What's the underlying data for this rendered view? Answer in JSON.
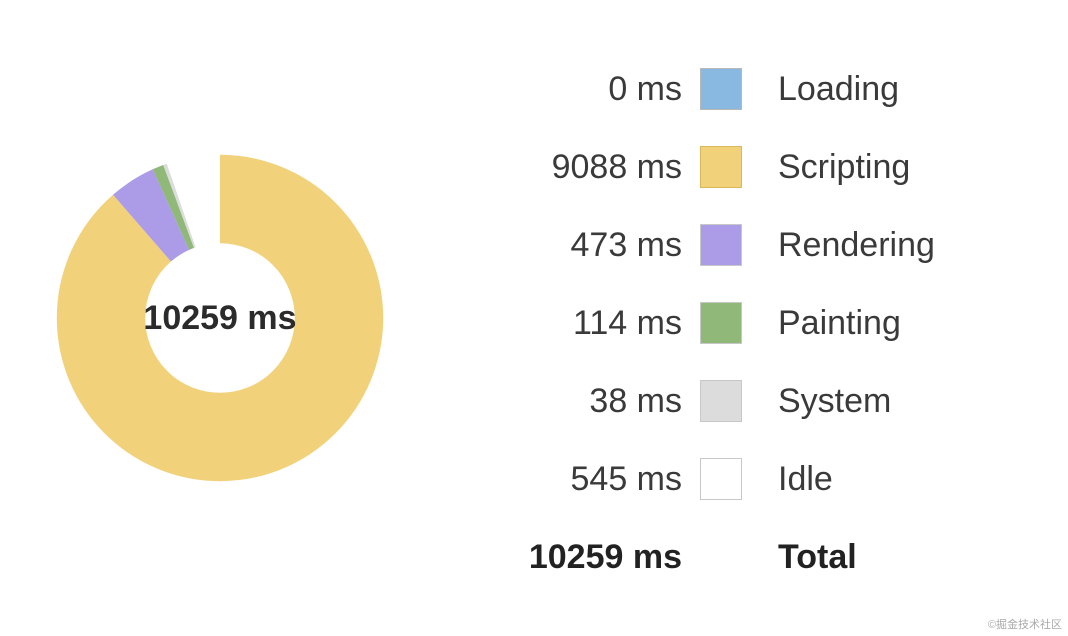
{
  "unit_suffix": " ms",
  "center_total": "10259 ms",
  "total_value": "10259 ms",
  "total_label": "Total",
  "watermark": "©掘金技术社区",
  "legend": [
    {
      "value": "0 ms",
      "label": "Loading",
      "color": "#89b8e0",
      "border": "#b8b8b8"
    },
    {
      "value": "9088 ms",
      "label": "Scripting",
      "color": "#f2d17b",
      "border": "#d9b85a"
    },
    {
      "value": "473 ms",
      "label": "Rendering",
      "color": "#ac9be6",
      "border": "#c8c8c8"
    },
    {
      "value": "114 ms",
      "label": "Painting",
      "color": "#8fb879",
      "border": "#c8c8c8"
    },
    {
      "value": "38 ms",
      "label": "System",
      "color": "#dcdcdc",
      "border": "#c8c8c8"
    },
    {
      "value": "545 ms",
      "label": "Idle",
      "color": "#ffffff",
      "border": "#c8c8c8"
    }
  ],
  "chart_data": {
    "type": "pie",
    "title": "",
    "categories": [
      "Loading",
      "Scripting",
      "Rendering",
      "Painting",
      "System",
      "Idle"
    ],
    "values": [
      0,
      9088,
      473,
      114,
      38,
      545
    ],
    "total": 10259,
    "unit": "ms",
    "colors": [
      "#89b8e0",
      "#f2d17b",
      "#ac9be6",
      "#8fb879",
      "#dcdcdc",
      "#ffffff"
    ]
  }
}
